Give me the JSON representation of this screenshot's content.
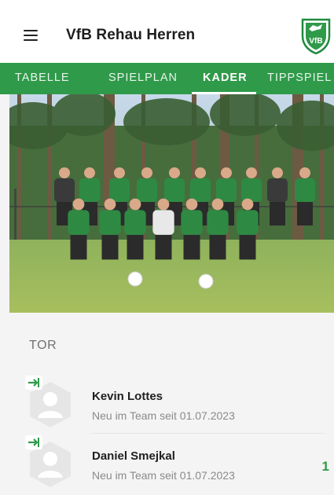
{
  "app": {
    "title": "VfB Rehau Herren",
    "accent_color": "#2f9a4a",
    "menu_icon": "hamburger-menu-icon",
    "logo": {
      "name": "club-crest-logo",
      "letters": "VfB"
    }
  },
  "tabs": [
    {
      "label": "TABELLE",
      "active": false
    },
    {
      "label": "SPIELPLAN",
      "active": false
    },
    {
      "label": "KADER",
      "active": true
    },
    {
      "label": "TIPPSPIEL",
      "active": false
    }
  ],
  "team_photo": {
    "name": "team-photo"
  },
  "roster": {
    "section_title": "TOR",
    "players": [
      {
        "name": "Kevin Lottes",
        "info": "Neu im Team seit 01.07.2023",
        "number": "",
        "badge_icon": "new-arrival-arrow-icon"
      },
      {
        "name": "Daniel Smejkal",
        "info": "Neu im Team seit 01.07.2023",
        "number": "1",
        "badge_icon": "new-arrival-arrow-icon"
      }
    ]
  }
}
